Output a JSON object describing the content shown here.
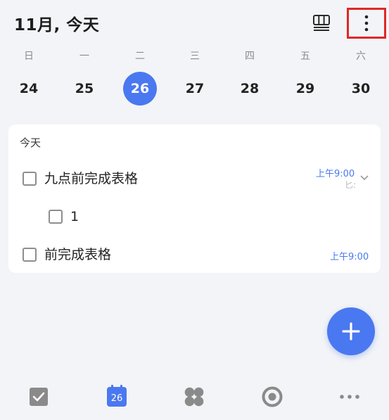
{
  "header": {
    "title": "11月, 今天"
  },
  "week": {
    "days": [
      {
        "weekday": "日",
        "date": "24",
        "selected": false
      },
      {
        "weekday": "一",
        "date": "25",
        "selected": false
      },
      {
        "weekday": "二",
        "date": "26",
        "selected": true
      },
      {
        "weekday": "三",
        "date": "27",
        "selected": false
      },
      {
        "weekday": "四",
        "date": "28",
        "selected": false
      },
      {
        "weekday": "五",
        "date": "29",
        "selected": false
      },
      {
        "weekday": "六",
        "date": "30",
        "selected": false
      }
    ]
  },
  "tasks": {
    "section_title": "今天",
    "items": [
      {
        "text": "九点前完成表格",
        "time": "上午9:00",
        "hint": "匕:"
      },
      {
        "text": "1"
      },
      {
        "text": "前完成表格",
        "time": "上午9:00"
      }
    ]
  },
  "bottom_nav": {
    "calendar_date": "26"
  },
  "icons": {
    "layout": "layout-icon",
    "more": "more-vertical-icon",
    "expand": "chevron-down-icon",
    "add": "plus-icon",
    "tasks": "checkbox-icon",
    "calendar": "calendar-icon",
    "matrix": "four-leaf-icon",
    "focus": "focus-icon",
    "more_nav": "more-horizontal-icon"
  },
  "colors": {
    "accent": "#4a78f0",
    "background": "#f3f4f7",
    "card": "#ffffff",
    "highlight_border": "#e02727"
  }
}
